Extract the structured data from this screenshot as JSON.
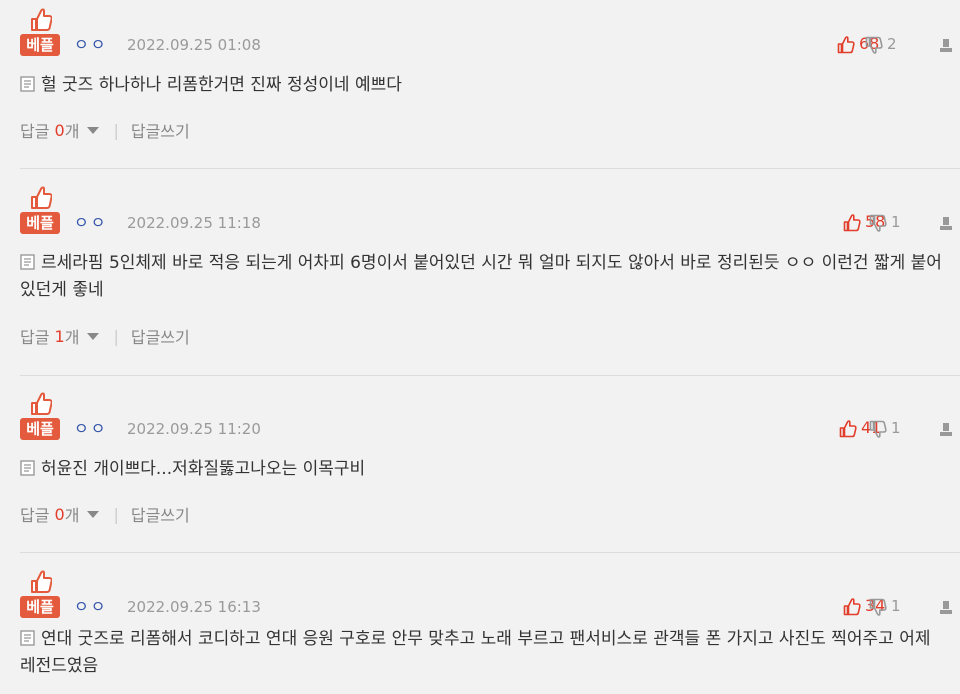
{
  "best_label": "베플",
  "reply_label": "답글",
  "count_suffix": "개",
  "write_reply_label": "답글쓰기",
  "separator": "|",
  "colors": {
    "accent_red": "#e23c2a",
    "badge": "#e35b3c",
    "nick": "#3355aa",
    "muted": "#9a9a9a"
  },
  "comments": [
    {
      "nickname": "ㅇㅇ",
      "date": "2022.09.25 01:08",
      "likes": "68",
      "dislikes": "2",
      "text": "헐 굿즈 하나하나 리폼한거면 진짜 정성이네 예쁘다",
      "reply_count": "0"
    },
    {
      "nickname": "ㅇㅇ",
      "date": "2022.09.25 11:18",
      "likes": "58",
      "dislikes": "1",
      "text": "르세라핌 5인체제 바로 적응 되는게 어차피 6명이서 붙어있던 시간 뭐 얼마 되지도 않아서 바로 정리된듯 ㅇㅇ 이런건 짧게 붙어있던게 좋네",
      "reply_count": "1"
    },
    {
      "nickname": "ㅇㅇ",
      "date": "2022.09.25 11:20",
      "likes": "41",
      "dislikes": "1",
      "text": "허윤진 개이쁘다...저화질뚫고나오는 이목구비",
      "reply_count": "0"
    },
    {
      "nickname": "ㅇㅇ",
      "date": "2022.09.25 16:13",
      "likes": "34",
      "dislikes": "1",
      "text": "연대 굿즈로 리폼해서 코디하고 연대 응원 구호로 안무 맞추고 노래 부르고 팬서비스로 관객들 폰 가지고 사진도 찍어주고 어제 레전드였음",
      "reply_count": ""
    }
  ]
}
